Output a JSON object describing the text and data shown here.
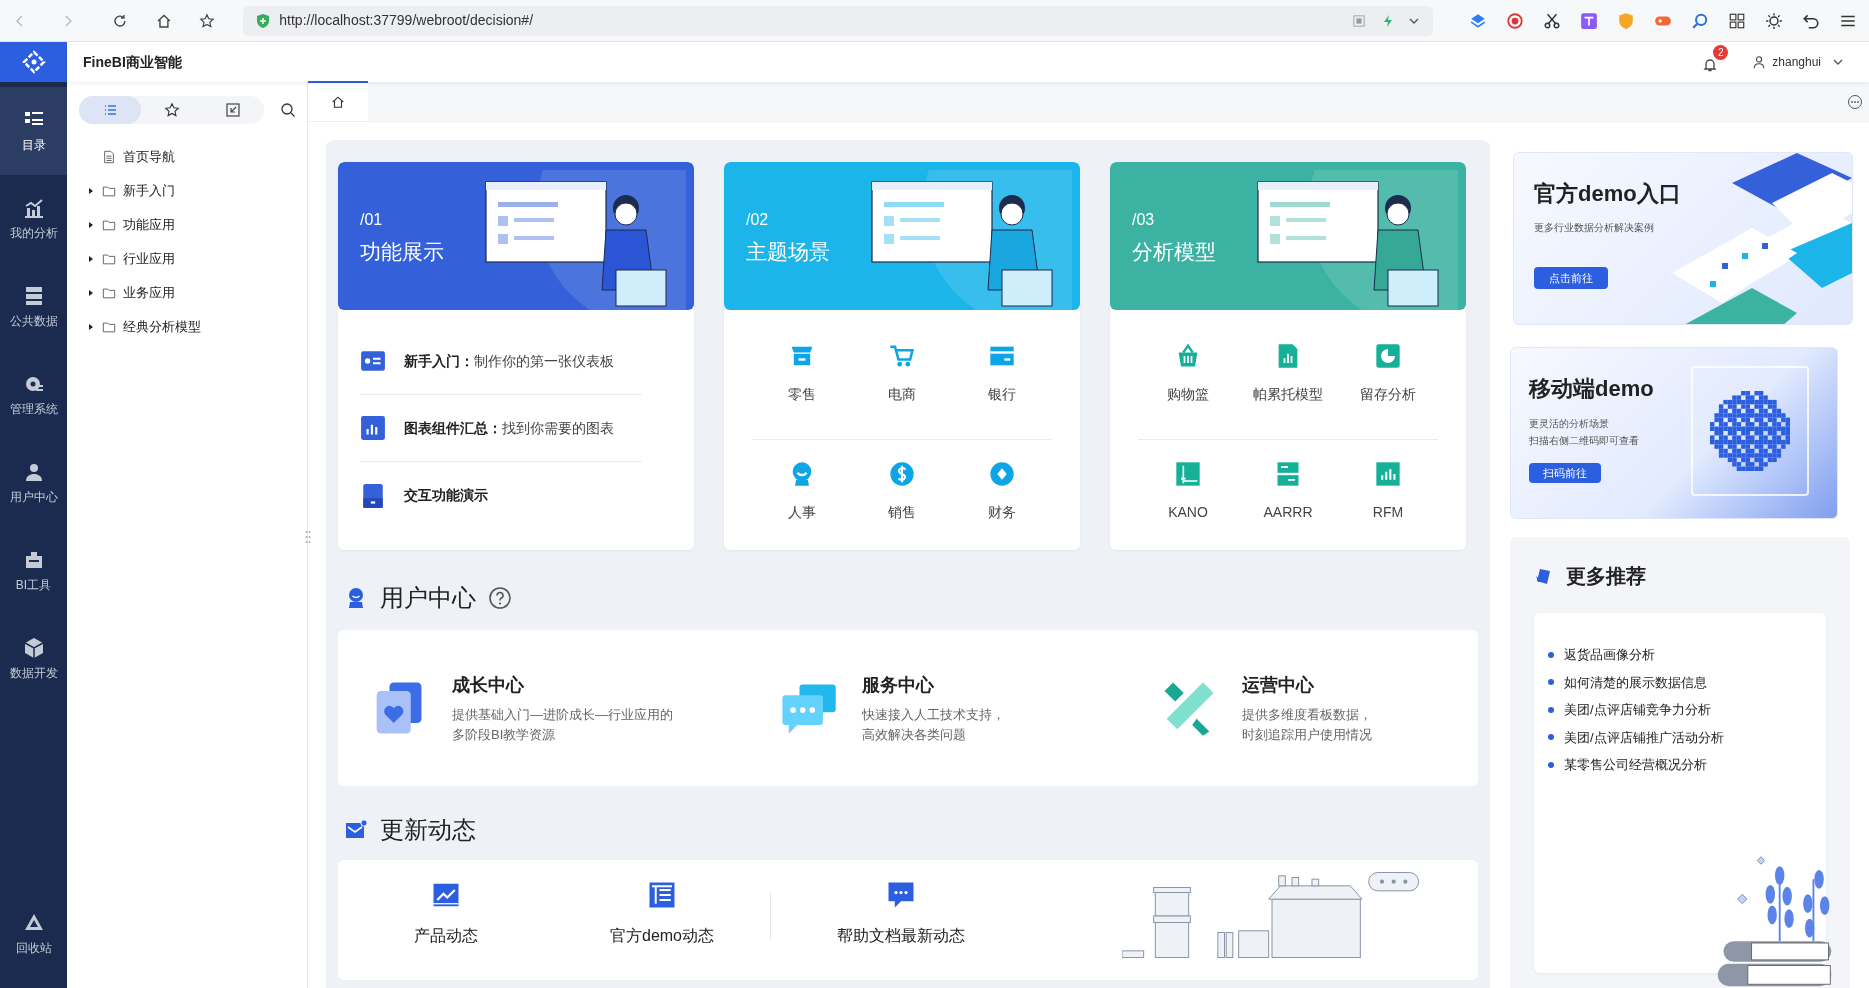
{
  "browser": {
    "url": "http://localhost:37799/webroot/decision#/"
  },
  "header": {
    "title": "FineBI商业智能",
    "notification_count": "2",
    "user": "zhanghui"
  },
  "nav": {
    "items": [
      {
        "label": "目录",
        "selected": true
      },
      {
        "label": "我的分析",
        "selected": false
      },
      {
        "label": "公共数据",
        "selected": false
      },
      {
        "label": "管理系统",
        "selected": false
      },
      {
        "label": "用户中心",
        "selected": false
      },
      {
        "label": "BI工具",
        "selected": false
      },
      {
        "label": "数据开发",
        "selected": false
      }
    ],
    "bottom": {
      "label": "回收站",
      "selected": false
    }
  },
  "tree": {
    "tabs": [
      {
        "selected": true
      },
      {
        "selected": false
      },
      {
        "selected": false
      }
    ],
    "items": [
      {
        "label": "首页导航",
        "kind": "file"
      },
      {
        "label": "新手入门",
        "kind": "folder",
        "expanded": false
      },
      {
        "label": "功能应用",
        "kind": "folder",
        "expanded": false
      },
      {
        "label": "行业应用",
        "kind": "folder",
        "expanded": false
      },
      {
        "label": "业务应用",
        "kind": "folder",
        "expanded": false
      },
      {
        "label": "经典分析模型",
        "kind": "folder",
        "expanded": false
      }
    ]
  },
  "content_tabs": [
    {
      "selected": true
    }
  ],
  "cards": [
    {
      "number": "/01",
      "title": "功能展示",
      "kind": "list",
      "color": "#3461d9",
      "items": [
        "**新手入门：**制作你的第一张仪表板",
        "**图表组件汇总：**找到你需要的图表",
        "**交互功能演示**"
      ]
    },
    {
      "number": "/02",
      "title": "主题场景",
      "kind": "grid",
      "color": "#1cb5ea",
      "items": [
        "零售",
        "电商",
        "银行",
        "人事",
        "销售",
        "财务"
      ]
    },
    {
      "number": "/03",
      "title": "分析模型",
      "kind": "grid",
      "color": "#3cb3a2",
      "items": [
        "购物篮",
        "帕累托模型",
        "留存分析",
        "KANO",
        "AARRR",
        "RFM"
      ]
    }
  ],
  "user_center": {
    "title": "用户中心",
    "items": [
      {
        "title": "成长中心",
        "lines": [
          "提供基础入门—进阶成长—行业应用的",
          "多阶段BI教学资源"
        ]
      },
      {
        "title": "服务中心",
        "lines": [
          "快速接入人工技术支持，",
          "高效解决各类问题"
        ]
      },
      {
        "title": "运营中心",
        "lines": [
          "提供多维度看板数据，",
          "时刻追踪用户使用情况"
        ]
      }
    ]
  },
  "updates": {
    "title": "更新动态",
    "items": [
      "产品动态",
      "官方demo动态",
      "帮助文档最新动态"
    ]
  },
  "demo_banner": {
    "title": "官方demo入口",
    "subtitle": "更多行业数据分析解决案例",
    "button": "点击前往"
  },
  "mobile_banner": {
    "title": "移动端demo",
    "lines": [
      "更灵活的分析场景",
      "扫描右侧二维码即可查看"
    ],
    "button": "扫码前往"
  },
  "recommend": {
    "title": "更多推荐",
    "items": [
      "返货品画像分析",
      "如何清楚的展示数据信息",
      "美团/点评店铺竞争力分析",
      "美团/点评店铺推广活动分析",
      "某零售公司经营概况分析"
    ]
  }
}
